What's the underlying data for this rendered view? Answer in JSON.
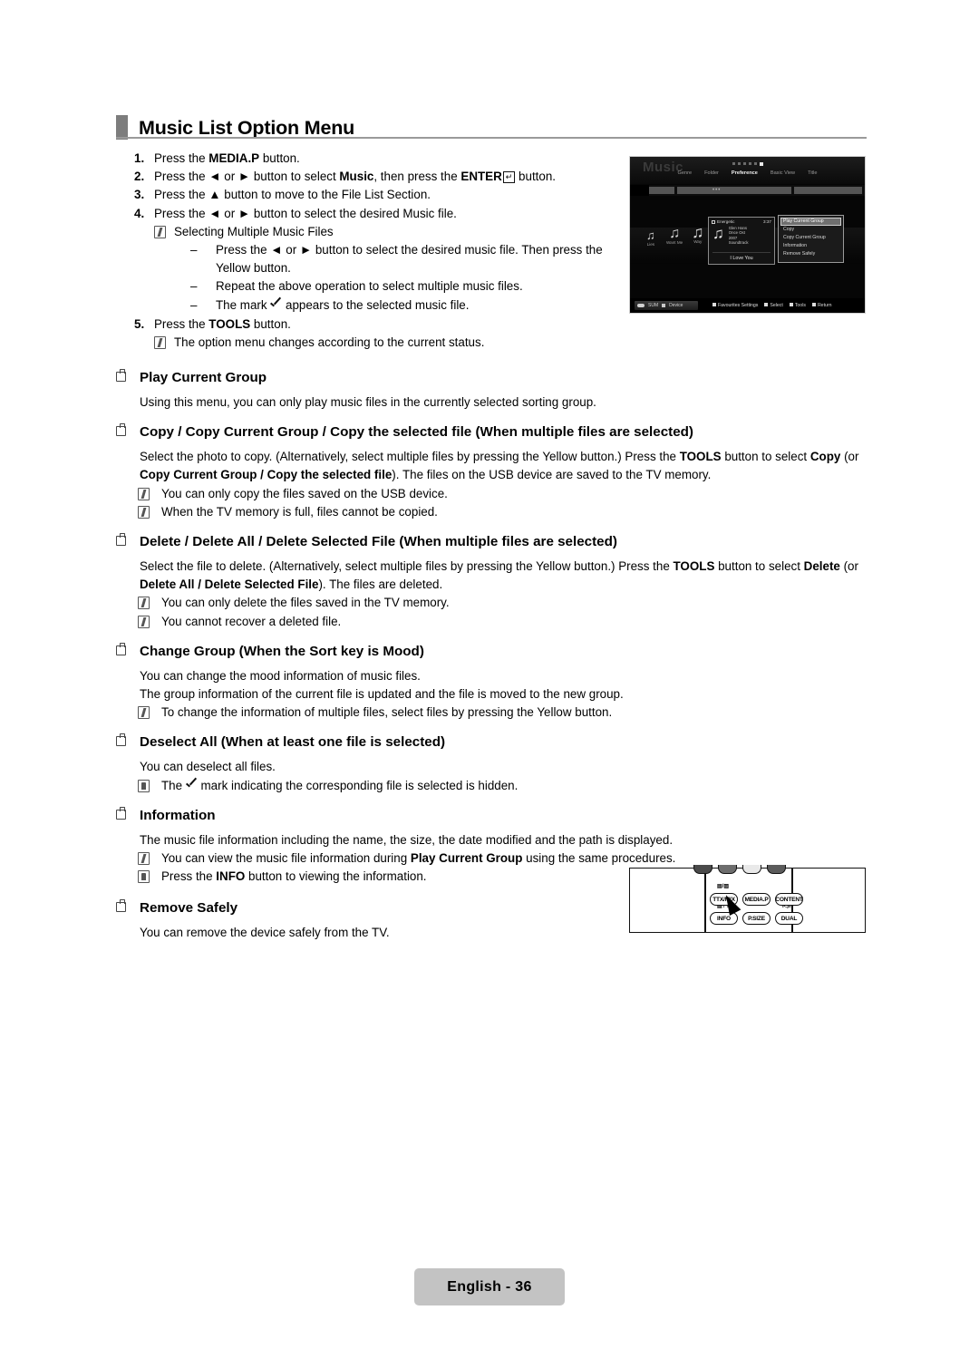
{
  "header": {
    "title": "Music List Option Menu"
  },
  "steps": [
    {
      "num": "1.",
      "text": "Press the MEDIA.P button.",
      "bold_parts": [
        "MEDIA.P"
      ]
    },
    {
      "num": "2.",
      "text": "Press the ◀ or ▶ button to select Music, then press the ENTER button.",
      "bold_parts": [
        "Music",
        "ENTER"
      ]
    },
    {
      "num": "3.",
      "text": "Press the ▲ button to move to the File List Section."
    },
    {
      "num": "4.",
      "text": "Press the ◀ or ▶ button to select the desired Music file."
    },
    {
      "num": "5.",
      "text": "Press the TOOLS button.",
      "bold_parts": [
        "TOOLS"
      ]
    }
  ],
  "step4_note": "Selecting Multiple Music Files",
  "step4_dashes": [
    "Press the ◀ or ▶ button to select the desired music file. Then press the Yellow button.",
    "Repeat the above operation to select multiple music files.",
    "The mark ✓ appears to the selected music file."
  ],
  "step5_note": "The option menu changes according to the current status.",
  "sections": [
    {
      "heading": "Play Current Group",
      "body": [
        "Using this menu, you can only play music files in the currently selected sorting group."
      ],
      "notes": []
    },
    {
      "heading": "Copy / Copy Current Group / Copy the selected file (When multiple files are selected)",
      "body": [
        "Select the photo to copy. (Alternatively, select multiple files by pressing the Yellow button.) Press the TOOLS button to select Copy (or Copy Current Group / Copy the selected file). The files on the USB device are saved to the TV memory."
      ],
      "notes": [
        "You can only copy the files saved on the USB device.",
        "When the TV memory is full, files cannot be copied."
      ]
    },
    {
      "heading": "Delete / Delete All / Delete Selected File (When multiple files are selected)",
      "body": [
        "Select the file to delete. (Alternatively, select multiple files by pressing the Yellow button.) Press the TOOLS button to select Delete (or Delete All / Delete Selected File). The files are deleted."
      ],
      "notes": [
        "You can only delete the files saved in the TV memory.",
        "You cannot recover a deleted file."
      ]
    },
    {
      "heading": "Change Group (When the Sort key is Mood)",
      "body": [
        "You can change the mood information of music files.",
        "The group information of the current file is updated and the file is moved to the new group."
      ],
      "notes": [
        "To change the information of multiple files, select files by pressing the Yellow button."
      ]
    },
    {
      "heading": "Deselect All (When at least one file is selected)",
      "body": [
        "You can deselect all files."
      ],
      "notes": [
        "The ✓ mark indicating the corresponding file is selected is hidden."
      ]
    },
    {
      "heading": "Information",
      "body": [
        "The music file information including the name, the size, the date modified and the path is displayed."
      ],
      "notes": [
        "You can view the music file information during Play Current Group using the same procedures.",
        "Press the INFO button to viewing the information."
      ]
    },
    {
      "heading": "Remove Safely",
      "body": [
        "You can remove the device safely from the TV."
      ],
      "notes": []
    }
  ],
  "tv_screen": {
    "watermark": "Music",
    "tabs": [
      "Genre",
      "Folder",
      "Preference",
      "Basic View",
      "Title"
    ],
    "selected_tab": "Preference",
    "scroll_dots": "•••",
    "files": [
      {
        "label": "Lies"
      },
      {
        "label": "Want Me"
      },
      {
        "label": "Way"
      }
    ],
    "card": {
      "mood": "Energetic",
      "duration": "3:37",
      "artist": "Glen Hans",
      "album": "Once Ost",
      "year": "2007",
      "genre": "Soundtrack",
      "title": "I Love You"
    },
    "option_menu": {
      "items": [
        "Play Current Group",
        "Copy",
        "Copy Current Group",
        "Information",
        "Remove Safely"
      ],
      "selected": "Play Current Group"
    },
    "bottom_bar": {
      "source": "SUM",
      "device": "Device",
      "hints": [
        "Favourites Settings",
        "Select",
        "Tools",
        "Return"
      ]
    }
  },
  "remote": {
    "row1": [
      "TTX/MIX",
      "MEDIA.P",
      "CONTENT"
    ],
    "row2": [
      "INFO",
      "P.SIZE",
      "DUAL"
    ],
    "mini_labels": [
      "▤/▨",
      "▤? i",
      "I◁II"
    ]
  },
  "footer": {
    "page_label": "English - 36"
  }
}
